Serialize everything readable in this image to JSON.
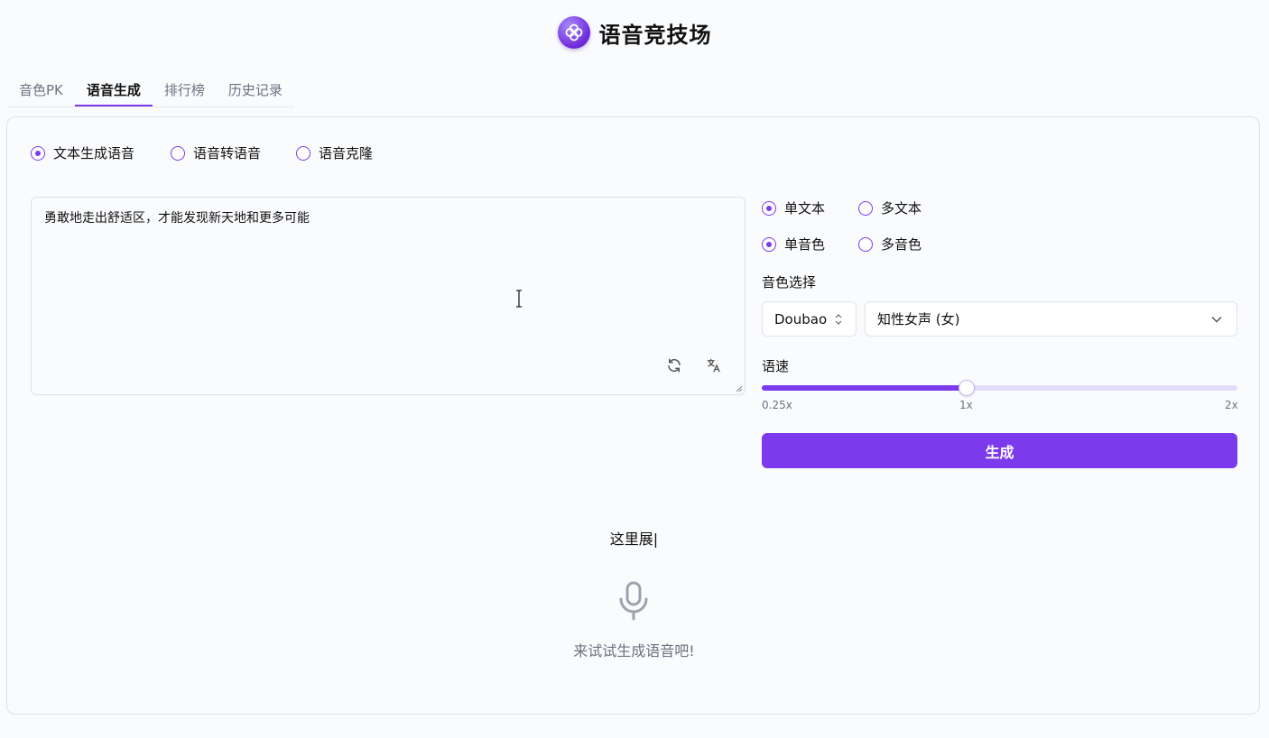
{
  "header": {
    "title": "语音竞技场",
    "logo_icon": "clover-logo"
  },
  "tabs": [
    {
      "label": "音色PK",
      "active": false
    },
    {
      "label": "语音生成",
      "active": true
    },
    {
      "label": "排行榜",
      "active": false
    },
    {
      "label": "历史记录",
      "active": false
    }
  ],
  "mode": {
    "options": [
      "文本生成语音",
      "语音转语音",
      "语音克隆"
    ],
    "selected": "文本生成语音"
  },
  "text_input": {
    "value": "勇敢地走出舒适区，才能发现新天地和更多可能",
    "refresh_icon": "refresh-icon",
    "translate_icon": "translate-icon"
  },
  "options": {
    "text_mode": [
      "单文本",
      "多文本"
    ],
    "text_mode_selected": "单文本",
    "voice_mode": [
      "单音色",
      "多音色"
    ],
    "voice_mode_selected": "单音色"
  },
  "voice": {
    "label": "音色选择",
    "provider": "Doubao",
    "voice_name": "知性女声 (女)"
  },
  "speed": {
    "label": "语速",
    "min_label": "0.25x",
    "mid_label": "1x",
    "max_label": "2x",
    "value_fraction": 0.43
  },
  "generate_button": "生成",
  "output": {
    "typing_text": "这里展|",
    "empty_hint": "来试试生成语音吧!",
    "icon": "microphone-icon"
  },
  "colors": {
    "accent": "#7c3aed",
    "track": "#e4dcfb"
  }
}
